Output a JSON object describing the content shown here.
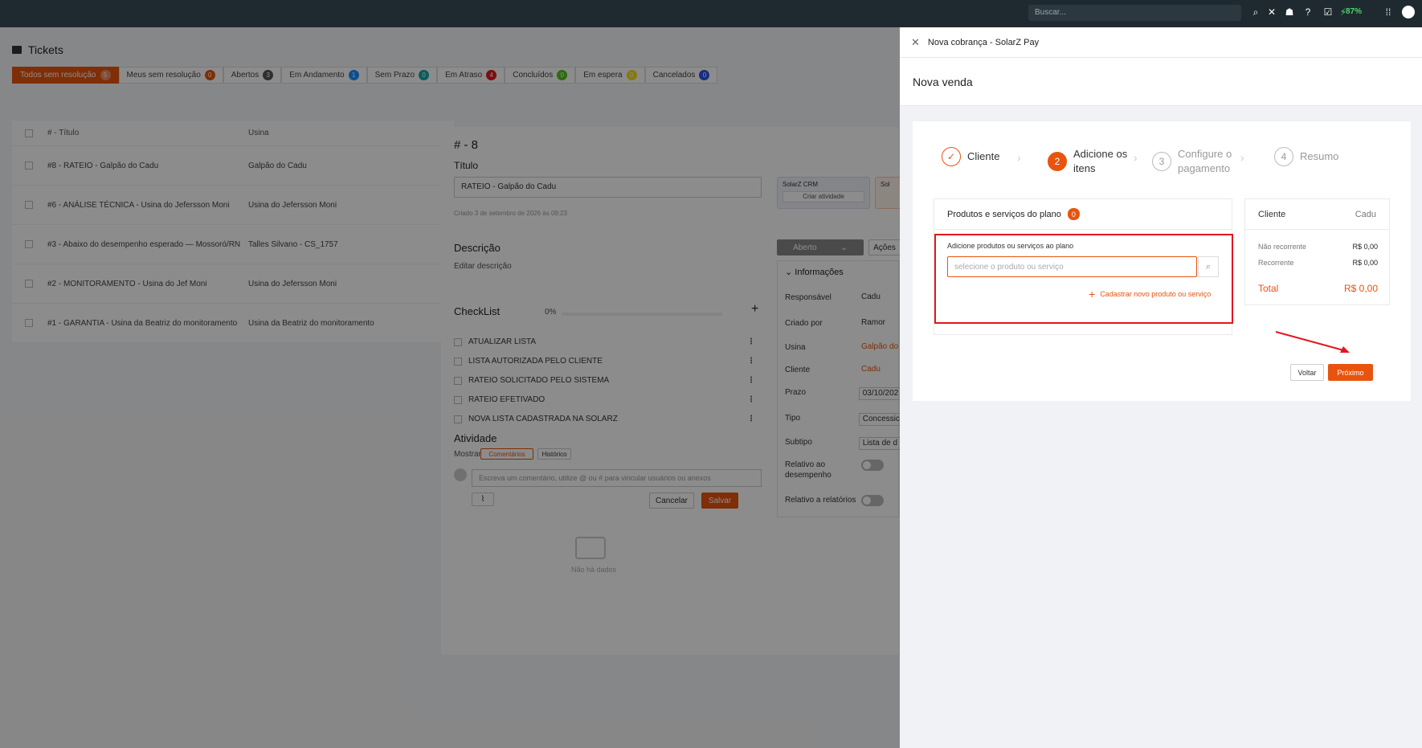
{
  "topbar": {
    "search_placeholder": "Buscar...",
    "icons": [
      "search-icon",
      "bell-off-icon",
      "hat-icon",
      "help-icon",
      "checklist-icon",
      "plug-icon",
      "apps-grid-icon"
    ],
    "battery": "87%"
  },
  "page": {
    "title": "Tickets",
    "tabs": [
      {
        "label": "Todos sem resolução",
        "count": "5",
        "color": "#e8540e"
      },
      {
        "label": "Meus sem resolução",
        "count": "0",
        "color": "#e8540e"
      },
      {
        "label": "Abertos",
        "count": "3",
        "color": "#555555"
      },
      {
        "label": "Em Andamento",
        "count": "1",
        "color": "#1890ff"
      },
      {
        "label": "Sem Prazo",
        "count": "0",
        "color": "#13a8a8"
      },
      {
        "label": "Em Atraso",
        "count": "4",
        "color": "#e3161f"
      },
      {
        "label": "Concluídos",
        "count": "0",
        "color": "#52c41a"
      },
      {
        "label": "Em espera",
        "count": "0",
        "color": "#fadb14"
      },
      {
        "label": "Cancelados",
        "count": "0",
        "color": "#2f54eb"
      }
    ],
    "table": {
      "headers": [
        "# - Título",
        "Usina"
      ],
      "rows": [
        {
          "title": "#8 - RATEIO - Galpão do Cadu",
          "usina": "Galpão do Cadu"
        },
        {
          "title": "#6 - ANÁLISE TÉCNICA - Usina do Jefersson Moni",
          "usina": "Usina do Jefersson Moni"
        },
        {
          "title": "#3 - Abaixo do desempenho esperado — Mossoró/RN",
          "usina": "Talles Silvano - CS_1757"
        },
        {
          "title": "#2 - MONITORAMENTO - Usina do Jef Moni",
          "usina": "Usina do Jefersson Moni"
        },
        {
          "title": "#1 - GARANTIA - Usina da Beatriz do monitoramento",
          "usina": "Usina da Beatriz do monitoramento"
        }
      ]
    }
  },
  "ticket": {
    "number": "# - 8",
    "title_label": "Título",
    "title_value": "RATEIO - Galpão do Cadu",
    "created": "Criado 3 de setembro de 2026 às 09:23",
    "crm_card_title": "SolarZ CRM",
    "crm_card_btn": "Criar atividade",
    "crm_card2_title": "Sol",
    "description_label": "Descrição",
    "description_link": "Editar descrição",
    "status_button": "Aberto",
    "actions_button": "Ações",
    "checklist_label": "CheckList",
    "checklist_progress": "0%",
    "checklist_items": [
      "ATUALIZAR LISTA",
      "LISTA AUTORIZADA PELO CLIENTE",
      "RATEIO SOLICITADO PELO SISTEMA",
      "RATEIO EFETIVADO",
      "NOVA LISTA CADASTRADA NA SOLARZ"
    ],
    "activity_label": "Atividade",
    "show_label": "Mostrar:",
    "show_comments": "Comentários",
    "show_history": "Histórico",
    "comment_placeholder": "Escreva um comentário, utilize @ ou # para vincular usuários ou anexos",
    "cancel": "Cancelar",
    "save": "Salvar",
    "empty": "Não há dados",
    "info_label": "Informações",
    "info": {
      "responsavel_label": "Responsável",
      "responsavel": "Cadu",
      "criado_label": "Criado por",
      "criado": "Ramor",
      "usina_label": "Usina",
      "usina": "Galpão do",
      "cliente_label": "Cliente",
      "cliente": "Cadu",
      "prazo_label": "Prazo",
      "prazo": "03/10/202",
      "tipo_label": "Tipo",
      "tipo": "Concessic",
      "subtipo_label": "Subtipo",
      "subtipo": "Lista de d",
      "relativo_label": "Relativo ao desempenho",
      "relatorios_label": "Relativo a relatórios"
    }
  },
  "drawer": {
    "title": "Nova cobrança - SolarZ Pay",
    "subtitle": "Nova venda",
    "steps": [
      {
        "num": "✓",
        "label": "Cliente",
        "state": "done"
      },
      {
        "num": "2",
        "label": "Adicione os itens",
        "state": "current"
      },
      {
        "num": "3",
        "label": "Configure o pagamento",
        "state": "pending"
      },
      {
        "num": "4",
        "label": "Resumo",
        "state": "pending"
      }
    ],
    "products_title": "Produtos e serviços do plano",
    "products_count": "0",
    "add_title": "Adicione produtos ou serviços ao plano",
    "search_placeholder": "selecione o produto ou serviço",
    "add_new": "Cadastrar novo produto ou serviço",
    "summary": {
      "client_label": "Cliente",
      "client_value": "Cadu",
      "non_recurring_label": "Não recorrente",
      "non_recurring_value": "R$ 0,00",
      "recurring_label": "Recorrente",
      "recurring_value": "R$ 0,00",
      "total_label": "Total",
      "total_value": "R$ 0,00"
    },
    "back": "Voltar",
    "next": "Próximo",
    "accent": "#e8540e",
    "highlight": "#e3161f"
  }
}
